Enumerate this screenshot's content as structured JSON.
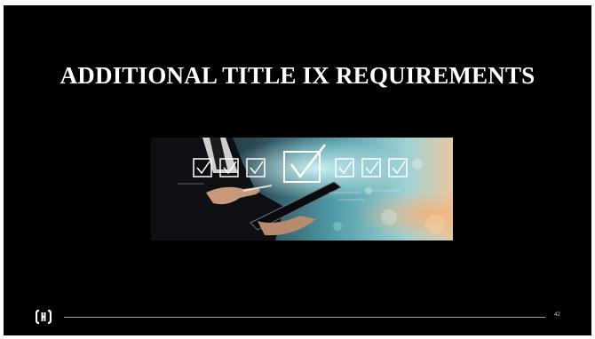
{
  "slide": {
    "title": "ADDITIONAL TITLE IX REQUIREMENTS",
    "page_number": "42",
    "image_icon": "checklist-tablet-photo",
    "logo_icon": "brand-logo-icon",
    "colors": {
      "background": "#000000",
      "title": "#ffffff",
      "rule": "#9aa89b",
      "accent_teal": "#6fd0d6"
    }
  }
}
